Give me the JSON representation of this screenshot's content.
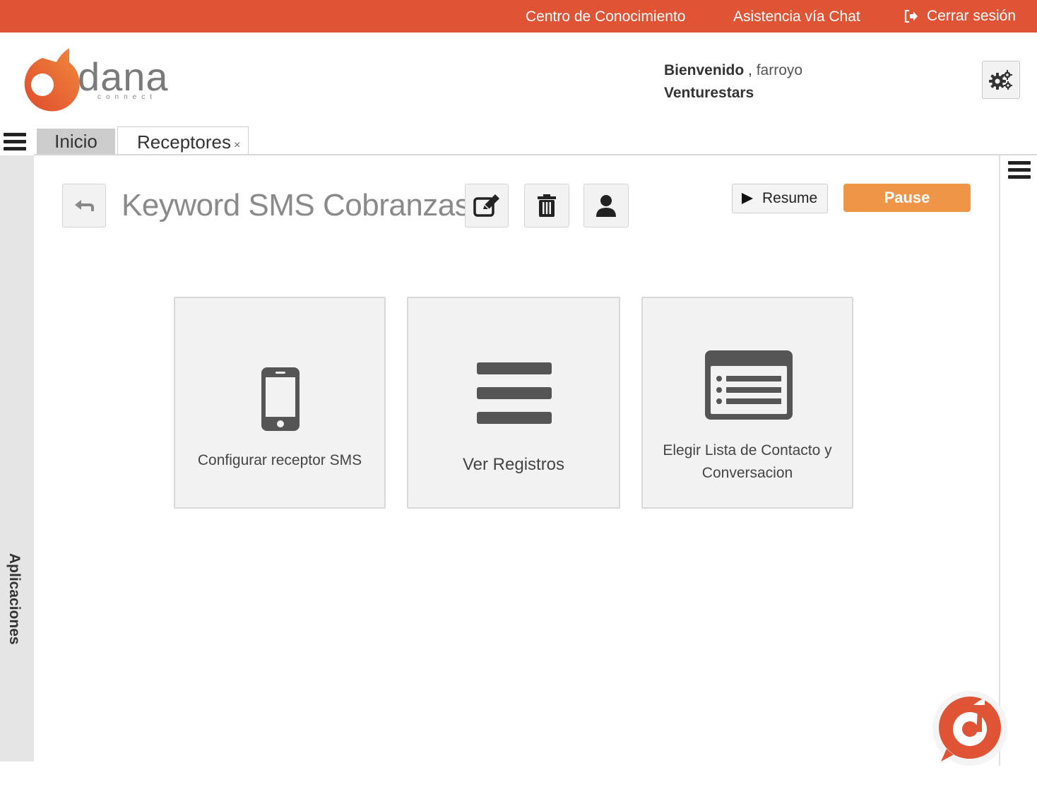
{
  "topbar": {
    "knowledge": "Centro de Conocimiento",
    "chat": "Asistencia vía Chat",
    "logout": "Cerrar sesión"
  },
  "brand": {
    "name": "dana",
    "sub": "connect"
  },
  "header": {
    "welcome": "Bienvenido",
    "separator": " ,",
    "user": "farroyo",
    "company": "Venturestars"
  },
  "tabs": [
    {
      "label": "Inicio"
    },
    {
      "label": "Receptores",
      "close": "×"
    }
  ],
  "sidebar": {
    "label": "Aplicaciones"
  },
  "page": {
    "title": "Keyword SMS Cobranzas",
    "resume": "Resume",
    "pause": "Pause"
  },
  "cards": [
    {
      "label": "Configurar receptor SMS",
      "icon": "mobile-phone-icon"
    },
    {
      "label": "Ver Registros",
      "icon": "bars-icon"
    },
    {
      "label": "Elegir Lista de Contacto y Conversacion",
      "icon": "list-window-icon"
    }
  ],
  "colors": {
    "topbar": "#e05436",
    "pause": "#ef9547",
    "icon": "#555555"
  }
}
